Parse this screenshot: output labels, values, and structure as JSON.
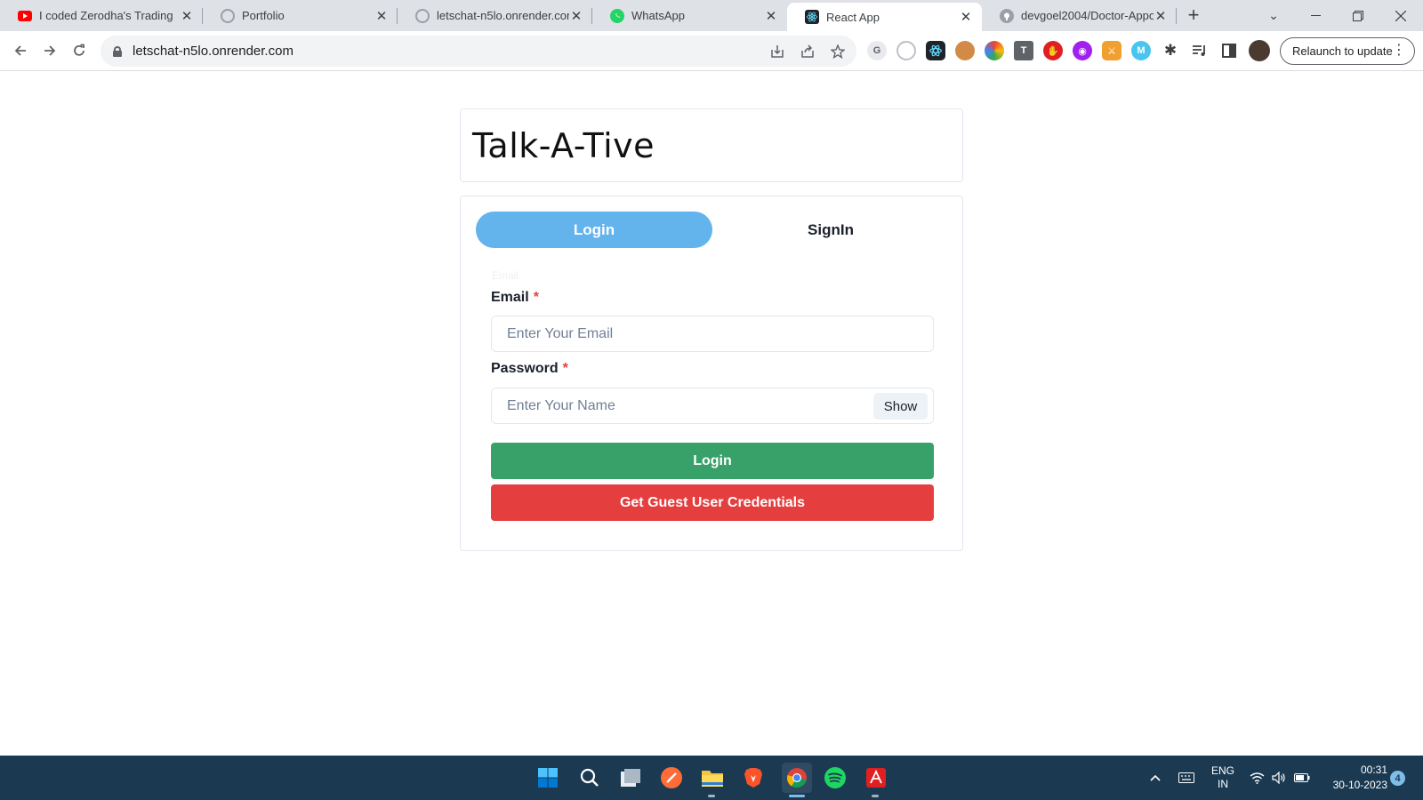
{
  "browser": {
    "tabs": [
      {
        "title": "I coded Zerodha's Trading",
        "favicon": "youtube-icon",
        "active": false
      },
      {
        "title": "Portfolio",
        "favicon": "globe-icon",
        "active": false
      },
      {
        "title": "letschat-n5lo.onrender.com",
        "favicon": "globe-icon",
        "active": false
      },
      {
        "title": "WhatsApp",
        "favicon": "whatsapp-icon",
        "active": false
      },
      {
        "title": "React App",
        "favicon": "react-icon",
        "active": true
      },
      {
        "title": "devgoel2004/Doctor-Appo",
        "favicon": "github-icon",
        "active": false
      }
    ],
    "url": "letschat-n5lo.onrender.com",
    "relaunch_label": "Relaunch to update",
    "colors": {
      "tabstrip": "#dee1e6",
      "omnibox": "#f1f3f4"
    }
  },
  "page": {
    "app_title": "Talk-A-Tive",
    "tabs": {
      "login": "Login",
      "signin": "SignIn"
    },
    "faint_text": "Email",
    "email": {
      "label": "Email",
      "required_mark": "*",
      "placeholder": "Enter Your Email",
      "value": ""
    },
    "password": {
      "label": "Password",
      "required_mark": "*",
      "placeholder": "Enter Your Name",
      "value": "",
      "toggle_label": "Show"
    },
    "login_button": "Login",
    "guest_button": "Get Guest User Credentials",
    "colors": {
      "active_tab": "#63b3ed",
      "login_button": "#38a169",
      "guest_button": "#e53e3e",
      "required": "#e53e3e"
    }
  },
  "taskbar": {
    "lang_primary": "ENG",
    "lang_secondary": "IN",
    "time": "00:31",
    "date": "30-10-2023",
    "notification_count": "4",
    "background": "#1b3a52"
  }
}
